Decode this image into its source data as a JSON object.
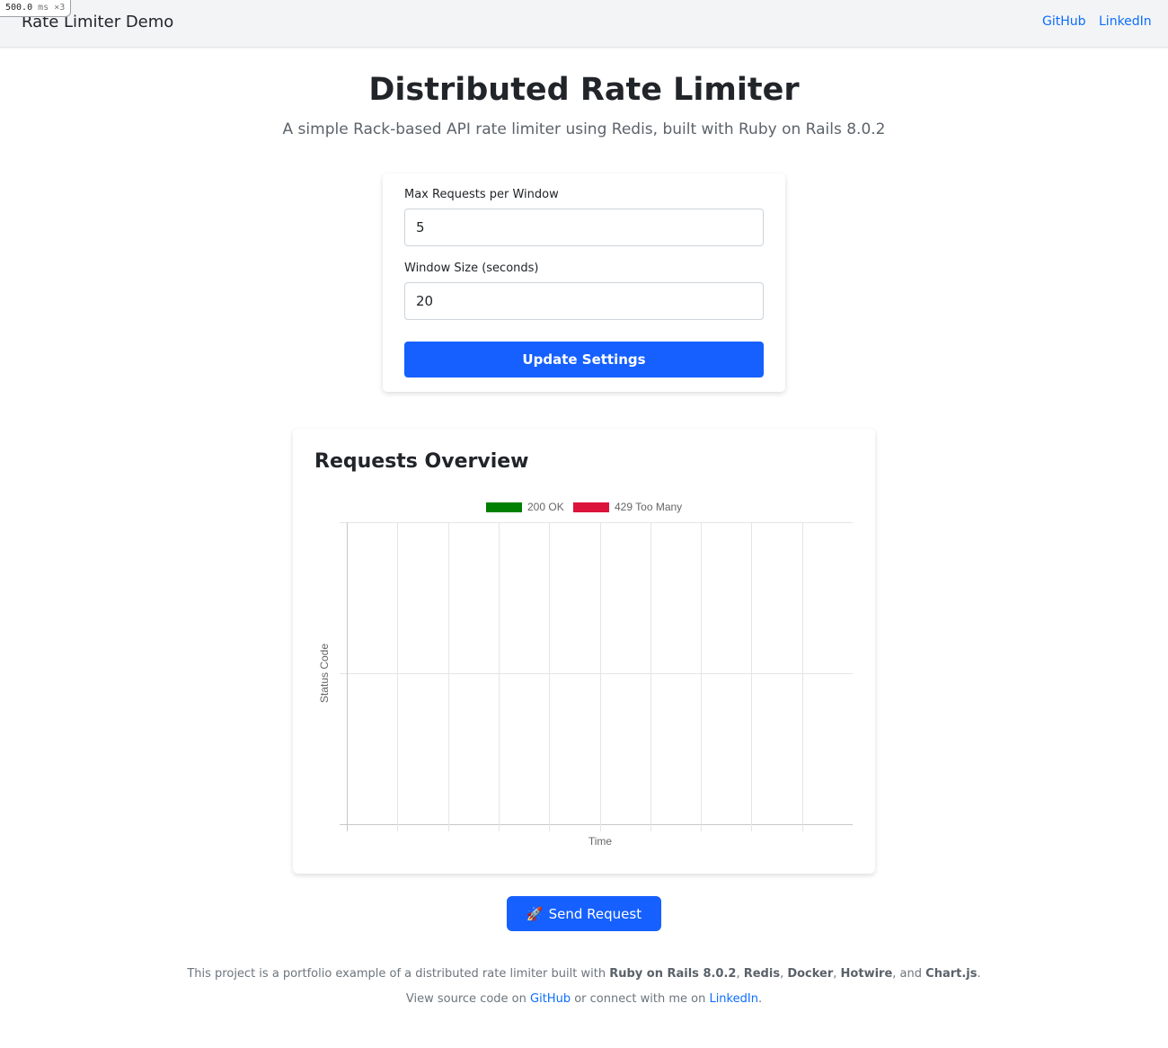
{
  "debug_badge": {
    "value": "500.0",
    "unit": "ms",
    "count": "×3"
  },
  "navbar": {
    "brand": "Rate Limiter Demo",
    "links": [
      "GitHub",
      "LinkedIn"
    ]
  },
  "header": {
    "title": "Distributed Rate Limiter",
    "subtitle": "A simple Rack-based API rate limiter using Redis, built with Ruby on Rails 8.0.2"
  },
  "settings": {
    "max_requests_label": "Max Requests per Window",
    "max_requests_value": "5",
    "window_size_label": "Window Size (seconds)",
    "window_size_value": "20",
    "update_button": "Update Settings"
  },
  "chart": {
    "title": "Requests Overview"
  },
  "chart_data": {
    "type": "bar",
    "title": "",
    "xlabel": "Time",
    "ylabel": "Status Code",
    "categories": [],
    "series": [
      {
        "name": "200 OK",
        "color": "#008000",
        "values": []
      },
      {
        "name": "429 Too Many",
        "color": "#dc143c",
        "values": []
      }
    ],
    "grid": true,
    "legend_position": "top"
  },
  "actions": {
    "send_button": "Send Request",
    "send_icon": "rocket-icon"
  },
  "footer": {
    "line1_prefix": "This project is a portfolio example of a distributed rate limiter built with",
    "tech": [
      "Ruby on Rails 8.0.2",
      "Redis",
      "Docker",
      "Hotwire",
      "Chart.js"
    ],
    "line1_and": "and",
    "line2_prefix": "View source code on",
    "line2_link1": "GitHub",
    "line2_middle": "or connect with me on",
    "line2_link2": "LinkedIn"
  }
}
